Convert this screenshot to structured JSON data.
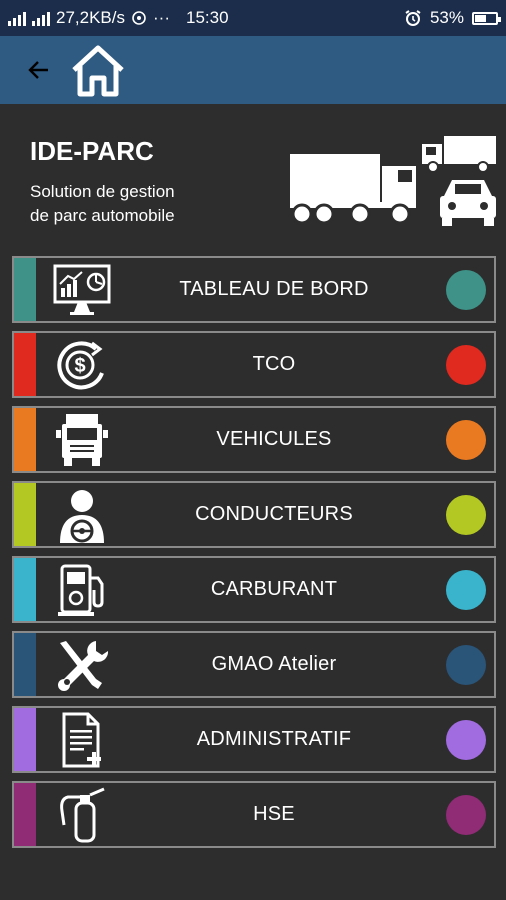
{
  "status_bar": {
    "network": "27,2KB/s",
    "dots": "···",
    "time": "15:30",
    "battery": "53%",
    "battery_level": 0.53
  },
  "app_bar": {
    "back_icon": "arrow-left-icon",
    "home_icon": "home-icon"
  },
  "header": {
    "title": "IDE-PARC",
    "subtitle_line1": "Solution de gestion",
    "subtitle_line2": "de parc automobile"
  },
  "menu": {
    "items": [
      {
        "label": "TABLEAU DE BORD",
        "color": "#3e9287",
        "icon": "dashboard-icon"
      },
      {
        "label": "TCO",
        "color": "#e0291f",
        "icon": "dollar-cycle-icon"
      },
      {
        "label": "VEHICULES",
        "color": "#ea7a22",
        "icon": "truck-icon"
      },
      {
        "label": "CONDUCTEURS",
        "color": "#b3c823",
        "icon": "driver-icon"
      },
      {
        "label": "CARBURANT",
        "color": "#39b4cc",
        "icon": "fuel-pump-icon"
      },
      {
        "label": "GMAO Atelier",
        "color": "#2a5478",
        "icon": "tools-icon"
      },
      {
        "label": "ADMINISTRATIF",
        "color": "#a06ce0",
        "icon": "document-icon"
      },
      {
        "label": "HSE",
        "color": "#902b76",
        "icon": "fire-extinguisher-icon"
      }
    ]
  }
}
